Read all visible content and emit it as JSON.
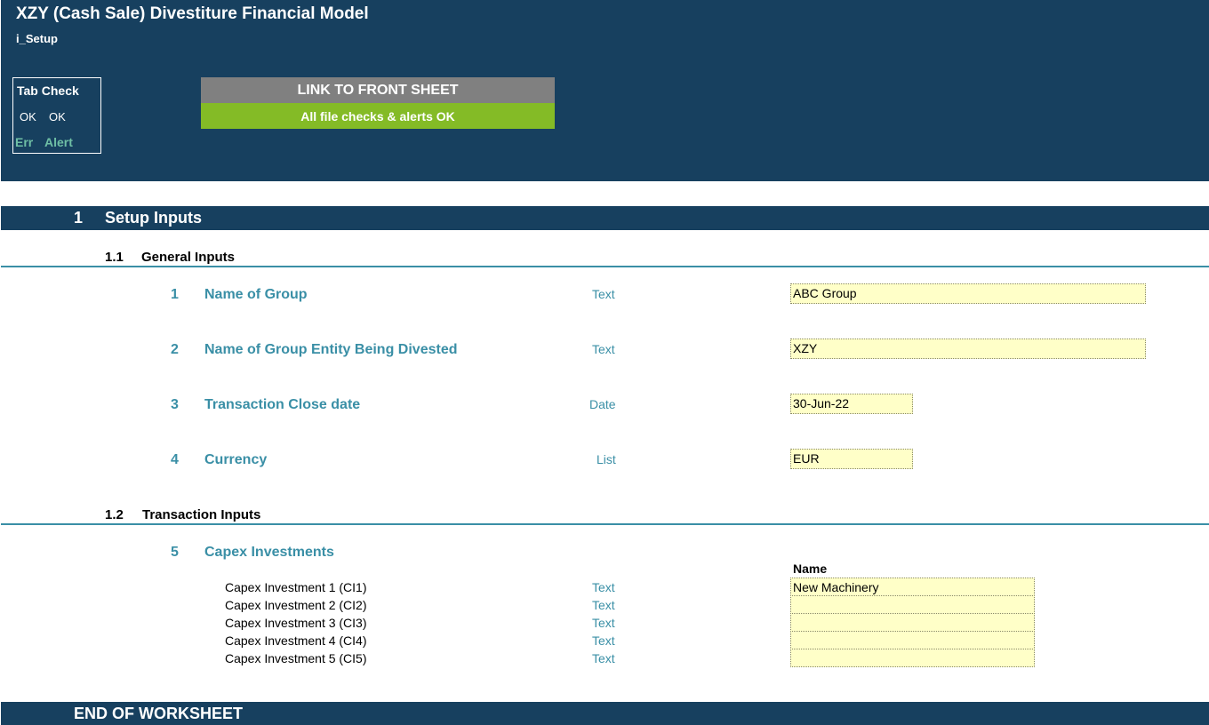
{
  "header": {
    "title": "XZY (Cash Sale) Divestiture Financial Model",
    "sheet_name": "i_Setup",
    "tab_check": {
      "title": "Tab Check",
      "err_status": "OK",
      "alert_status": "OK",
      "err_label": "Err",
      "alert_label": "Alert"
    },
    "link_button": "LINK TO FRONT SHEET",
    "status_message": "All file checks & alerts OK"
  },
  "section1": {
    "number": "1",
    "title": "Setup Inputs",
    "general": {
      "number": "1.1",
      "title": "General Inputs",
      "items": [
        {
          "num": "1",
          "label": "Name of Group",
          "type": "Text",
          "value": "ABC Group"
        },
        {
          "num": "2",
          "label": "Name of Group Entity Being Divested",
          "type": "Text",
          "value": "XZY"
        },
        {
          "num": "3",
          "label": "Transaction Close date",
          "type": "Date",
          "value": "30-Jun-22"
        },
        {
          "num": "4",
          "label": "Currency",
          "type": "List",
          "value": "EUR"
        }
      ]
    },
    "transaction": {
      "number": "1.2",
      "title": "Transaction Inputs",
      "capex": {
        "num": "5",
        "label": "Capex Investments",
        "column_header": "Name",
        "rows": [
          {
            "label": "Capex Investment 1 (CI1)",
            "type": "Text",
            "value": "New Machinery"
          },
          {
            "label": "Capex Investment 2 (CI2)",
            "type": "Text",
            "value": ""
          },
          {
            "label": "Capex Investment 3 (CI3)",
            "type": "Text",
            "value": ""
          },
          {
            "label": "Capex Investment 4 (CI4)",
            "type": "Text",
            "value": ""
          },
          {
            "label": "Capex Investment 5 (CI5)",
            "type": "Text",
            "value": ""
          }
        ]
      }
    }
  },
  "footer": {
    "end_label": "END OF WORKSHEET"
  },
  "colors": {
    "header_bg": "#17405f",
    "accent_teal": "#3a8fa6",
    "ok_green": "#84bb26",
    "link_grey": "#808080",
    "input_cell": "#ffffc8",
    "check_label": "#6fbfa5"
  }
}
